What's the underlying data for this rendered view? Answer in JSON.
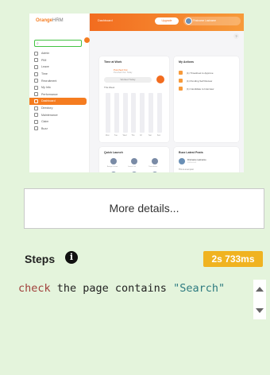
{
  "thumbnail": {
    "logo_name": "Orange",
    "logo_suffix": "HRM",
    "topbar_title": "Dashboard",
    "upgrade_label": "Upgrade",
    "user_label": "Firstname Lastname",
    "help_glyph": "?",
    "nav_items": [
      "Admin",
      "PIM",
      "Leave",
      "Time",
      "Recruitment",
      "My Info",
      "Performance",
      "Dashboard",
      "Directory",
      "Maintenance",
      "Claim",
      "Buzz"
    ],
    "active_nav_index": 7,
    "cards": {
      "time_title": "Time at Work",
      "punch_label": "Punched Out",
      "punch_sub": "Punched Out: Today",
      "punch_button": "Worked Today",
      "week_label": "This Week",
      "days": [
        "Mon",
        "Tue",
        "Wed",
        "Thu",
        "Fri",
        "Sat",
        "Sun"
      ],
      "actions_title": "My Actions",
      "actions": [
        "(1) Timesheet to Approve",
        "(1) Pending Self Review",
        "(1) Candidate to Interview"
      ],
      "quick_title": "Quick Launch",
      "quick_items": [
        "Assign Leave",
        "Leave List",
        "Timesheets",
        "Apply Leave",
        "My Leave",
        "My Timesheet"
      ],
      "posts_title": "Buzz Latest Posts",
      "post_author": "Firstname Lastname",
      "post_date": "2023-01-01",
      "post_body": "This is a test post"
    }
  },
  "more_details_label": "More details...",
  "steps": {
    "title": "Steps",
    "info_glyph": "i",
    "duration": "2s 733ms",
    "code_keyword": "check",
    "code_text": " the page contains ",
    "code_string": "\"Search\""
  },
  "colors": {
    "background": "#e4f4dc",
    "accent": "#f26c1f",
    "duration_badge": "#f0b321",
    "keyword": "#a0403b",
    "string": "#2e7b80"
  }
}
